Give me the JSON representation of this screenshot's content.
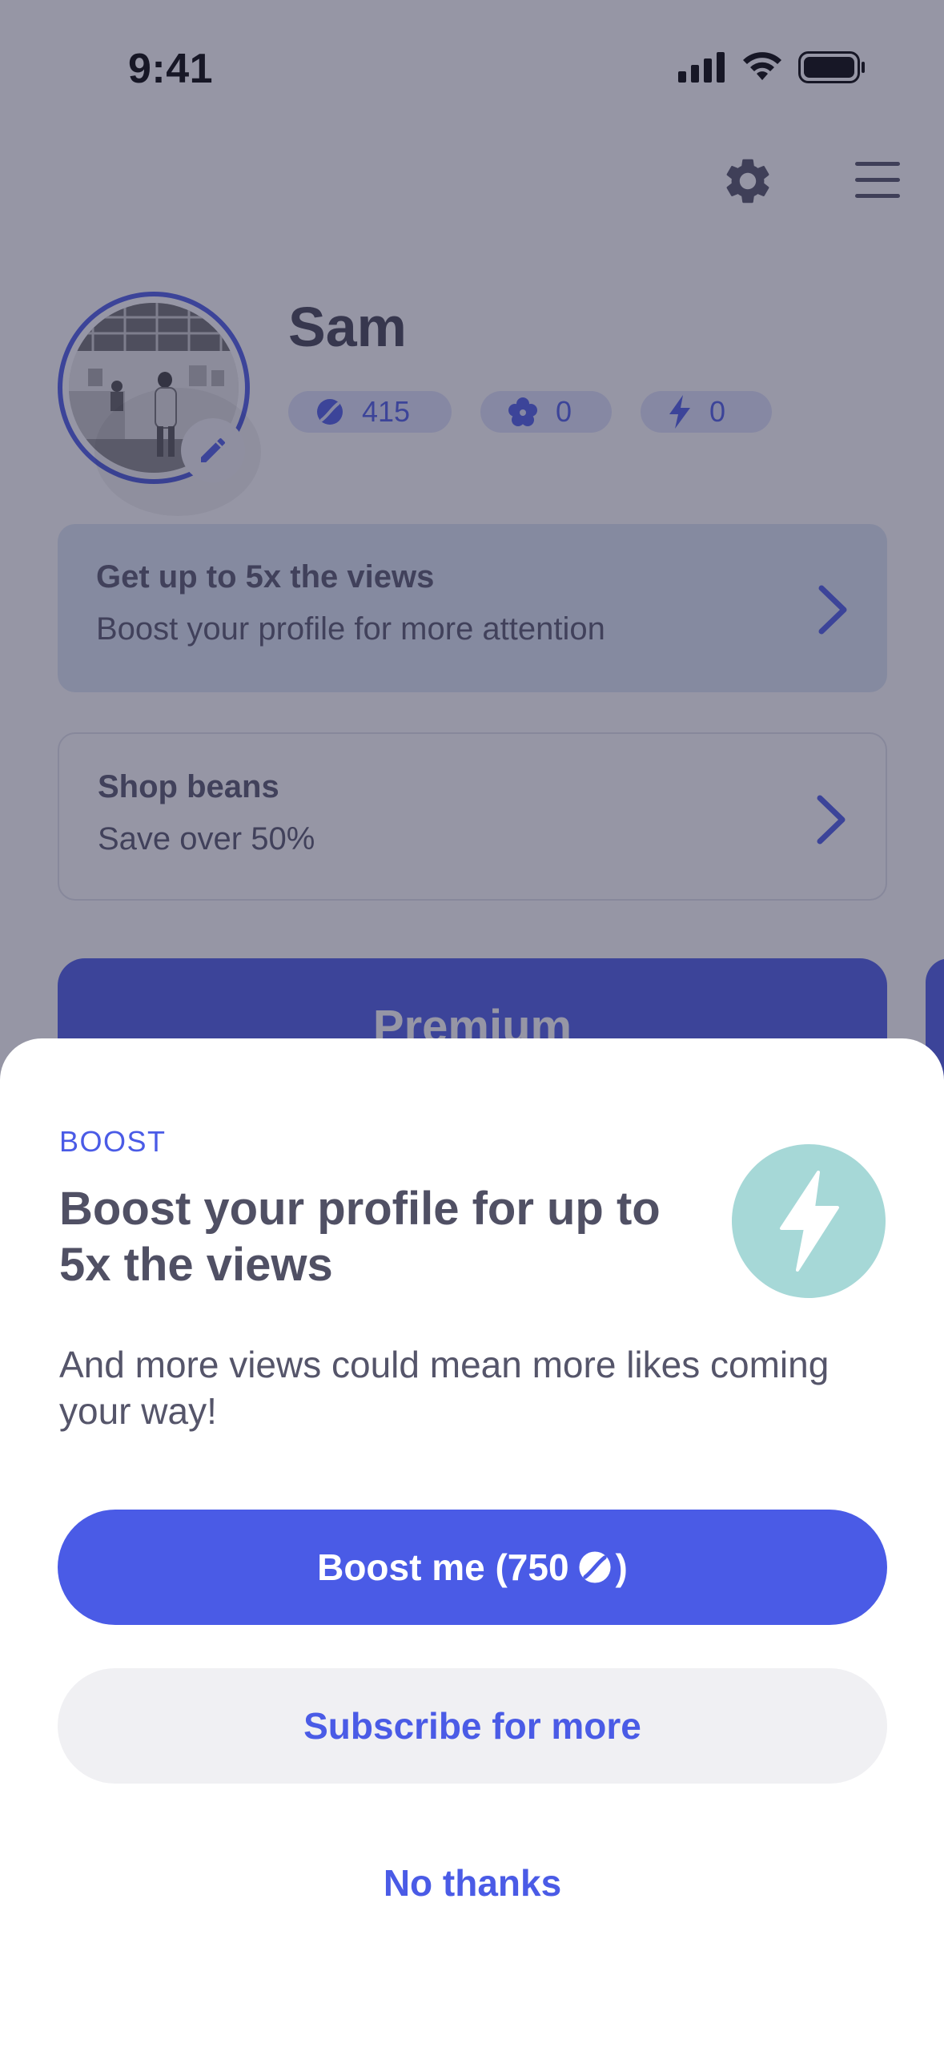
{
  "status_bar": {
    "time": "9:41"
  },
  "profile": {
    "name": "Sam",
    "stats": {
      "beans": "415",
      "likes": "0",
      "boosts": "0"
    }
  },
  "cards": {
    "boost": {
      "title": "Get up to 5x the views",
      "subtitle": "Boost your profile for more attention"
    },
    "shop": {
      "title": "Shop beans",
      "subtitle": "Save over 50%"
    }
  },
  "premium": {
    "label": "Premium"
  },
  "sheet": {
    "eyebrow": "BOOST",
    "title": "Boost your profile for up to 5x the views",
    "body": "And more views could mean more likes coming your way!",
    "primary_prefix": "Boost me (750",
    "primary_suffix": ")",
    "secondary_label": "Subscribe for more",
    "dismiss_label": "No thanks"
  },
  "colors": {
    "accent": "#4a5be6",
    "boost_icon_bg": "#a6d8d7",
    "overlay": "rgba(46,46,76,0.5)"
  },
  "icons": [
    "gear-icon",
    "menu-icon",
    "pencil-icon",
    "bean-icon",
    "flower-icon",
    "lightning-icon",
    "chevron-right-icon"
  ]
}
